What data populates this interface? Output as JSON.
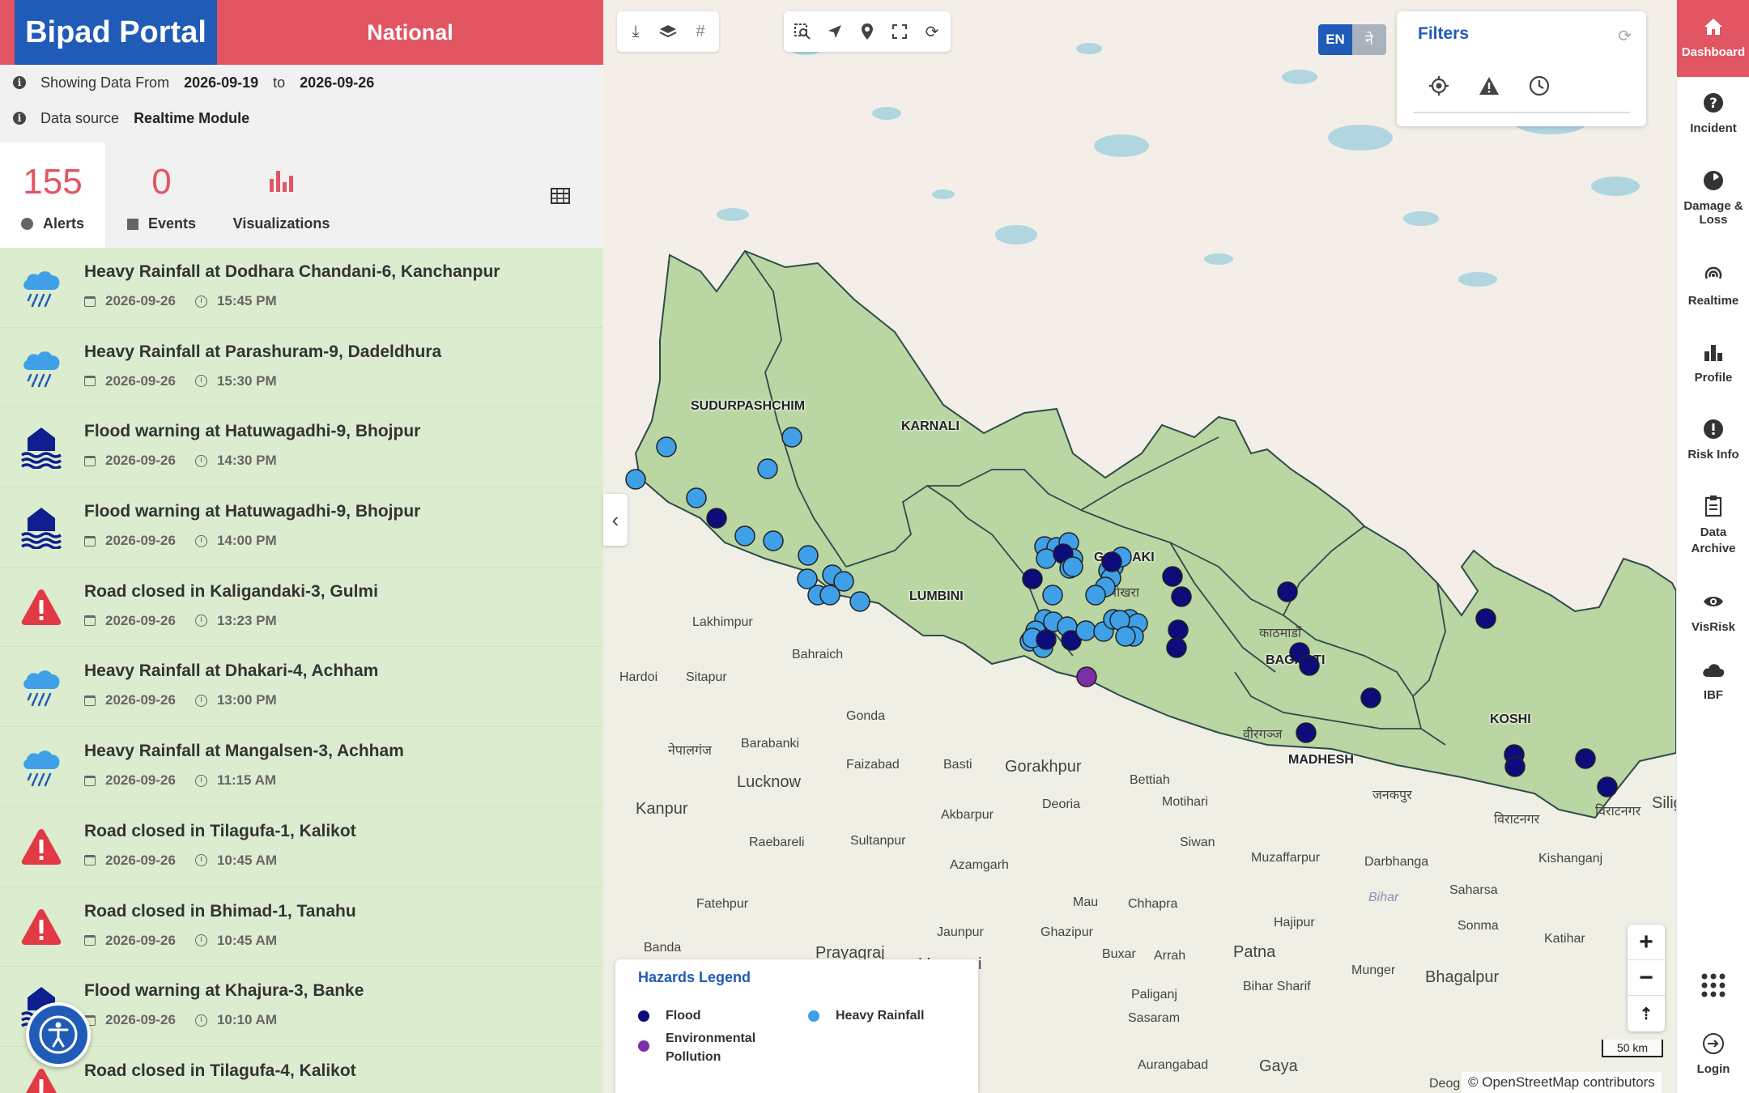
{
  "brand": {
    "title": "Bipad Portal",
    "region": "National"
  },
  "info": {
    "showing_label": "Showing Data From",
    "date_from": "2026-09-19",
    "to_label": "to",
    "date_to": "2026-09-26",
    "source_label": "Data source",
    "source_value": "Realtime Module"
  },
  "stats": {
    "alerts_count": "155",
    "alerts_label": "Alerts",
    "events_count": "0",
    "events_label": "Events",
    "visualizations_label": "Visualizations"
  },
  "alerts": [
    {
      "title": "Heavy Rainfall at Dodhara Chandani-6, Kanchanpur",
      "date": "2026-09-26",
      "time": "15:45 PM",
      "type": "rain"
    },
    {
      "title": "Heavy Rainfall at Parashuram-9, Dadeldhura",
      "date": "2026-09-26",
      "time": "15:30 PM",
      "type": "rain"
    },
    {
      "title": "Flood warning at Hatuwagadhi-9, Bhojpur",
      "date": "2026-09-26",
      "time": "14:30 PM",
      "type": "flood"
    },
    {
      "title": "Flood warning at Hatuwagadhi-9, Bhojpur",
      "date": "2026-09-26",
      "time": "14:00 PM",
      "type": "flood"
    },
    {
      "title": "Road closed in Kaligandaki-3, Gulmi",
      "date": "2026-09-26",
      "time": "13:23 PM",
      "type": "road"
    },
    {
      "title": "Heavy Rainfall at Dhakari-4, Achham",
      "date": "2026-09-26",
      "time": "13:00 PM",
      "type": "rain"
    },
    {
      "title": "Heavy Rainfall at Mangalsen-3, Achham",
      "date": "2026-09-26",
      "time": "11:15 AM",
      "type": "rain"
    },
    {
      "title": "Road closed in Tilagufa-1, Kalikot",
      "date": "2026-09-26",
      "time": "10:45 AM",
      "type": "road"
    },
    {
      "title": "Road closed in Bhimad-1, Tanahu",
      "date": "2026-09-26",
      "time": "10:45 AM",
      "type": "road"
    },
    {
      "title": "Flood warning at Khajura-3, Banke",
      "date": "2026-09-26",
      "time": "10:10 AM",
      "type": "flood"
    },
    {
      "title": "Road closed in Tilagufa-4, Kalikot",
      "date": "",
      "time": "",
      "type": "road"
    }
  ],
  "language": {
    "en": "EN",
    "ne": "ने"
  },
  "filters": {
    "title": "Filters"
  },
  "legend": {
    "title": "Hazards Legend",
    "items": [
      {
        "label": "Flood",
        "color": "#0c0c7a"
      },
      {
        "label": "Heavy Rainfall",
        "color": "#3fa0e8"
      },
      {
        "label": "Environmental Pollution",
        "color": "#7b2fa8"
      }
    ]
  },
  "map": {
    "provinces": [
      "SUDURPASHCHIM",
      "KARNALI",
      "LUMBINI",
      "GANDAKI",
      "BAGMATI",
      "MADHESH",
      "KOSHI"
    ],
    "cities": [
      "Lakhimpur",
      "Bahraich",
      "Hardoi",
      "Sitapur",
      "Gonda",
      "Barabanki",
      "Faizabad",
      "Basti",
      "Gorakhpur",
      "Lucknow",
      "Kanpur",
      "Akbarpur",
      "Deoria",
      "Bettiah",
      "Motihari",
      "Sultanpur",
      "Raebareli",
      "Azamgarh",
      "Siwan",
      "Muzaffarpur",
      "Darbhanga",
      "Saharsa",
      "Fatehpur",
      "Mau",
      "Chhapra",
      "Bihar",
      "Jaunpur",
      "Ghazipur",
      "Hajipur",
      "Banda",
      "Prayagraj",
      "Varanasi",
      "Buxar",
      "Arrah",
      "Patna",
      "Munger",
      "Bhagalpur",
      "Katihar",
      "Kishanganj",
      "Siliguri",
      "Sonma",
      "Paliganj",
      "Bihar Sharif",
      "Sasaram",
      "Aurangabad",
      "Gaya",
      "Deog"
    ],
    "local_labels": [
      "पोखरा",
      "काठमाडौं",
      "विराटनगर",
      "नेपालगंज",
      "वीरगञ्ज",
      "जनकपुर",
      "विराटनगर"
    ],
    "scale": "50 km",
    "attribution": "© OpenStreetMap contributors"
  },
  "nav": {
    "dashboard": "Dashboard",
    "incident": "Incident",
    "damage": "Damage & Loss",
    "realtime": "Realtime",
    "profile": "Profile",
    "risk": "Risk Info",
    "archive": "Data Archive",
    "visrisk": "VisRisk",
    "ibf": "IBF",
    "login": "Login"
  }
}
